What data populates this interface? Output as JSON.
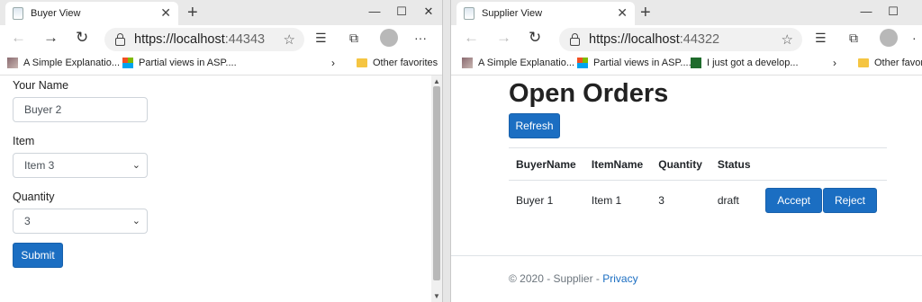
{
  "left": {
    "tab_title": "Buyer View",
    "url_host": "https://localhost",
    "url_port": ":44343",
    "favorites": [
      {
        "label": "A Simple Explanatio...",
        "icon": "image-icon"
      },
      {
        "label": "Partial views in ASP....",
        "icon": "microsoft-icon"
      }
    ],
    "other_favorites": "Other favorites",
    "form": {
      "name_label": "Your Name",
      "name_value": "Buyer 2",
      "item_label": "Item",
      "item_value": "Item 3",
      "quantity_label": "Quantity",
      "quantity_value": "3",
      "submit_label": "Submit"
    }
  },
  "right": {
    "tab_title": "Supplier View",
    "url_host": "https://localhost",
    "url_port": ":44322",
    "favorites": [
      {
        "label": "A Simple Explanatio...",
        "icon": "image-icon"
      },
      {
        "label": "Partial views in ASP....",
        "icon": "microsoft-icon"
      },
      {
        "label": "I just got a develop...",
        "icon": "stackoverflow-icon"
      }
    ],
    "other_favorites": "Other favori",
    "page_title": "Open Orders",
    "refresh_label": "Refresh",
    "table": {
      "headers": [
        "BuyerName",
        "ItemName",
        "Quantity",
        "Status"
      ],
      "rows": [
        {
          "buyer": "Buyer 1",
          "item": "Item 1",
          "quantity": "3",
          "status": "draft"
        }
      ]
    },
    "accept_label": "Accept",
    "reject_label": "Reject",
    "footer_prefix": "© 2020 - Supplier - ",
    "footer_link": "Privacy"
  },
  "colors": {
    "primary": "#1b6ec2",
    "text": "#212529",
    "muted": "#6c757d"
  }
}
